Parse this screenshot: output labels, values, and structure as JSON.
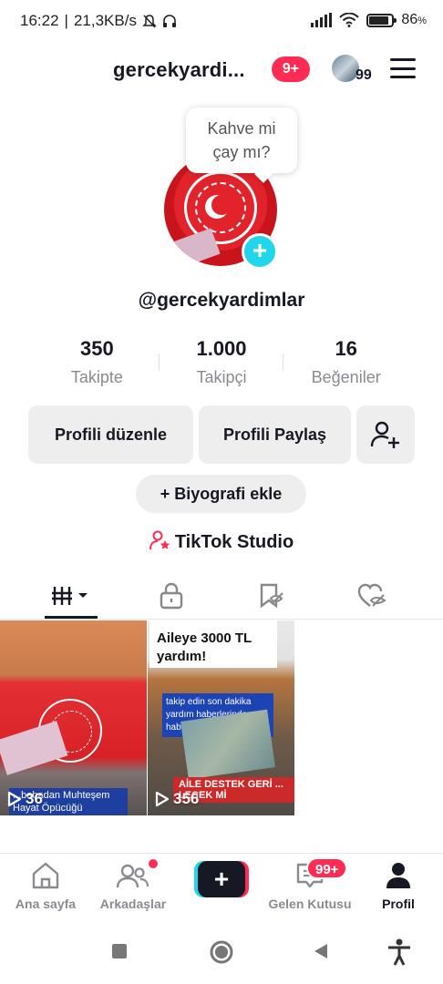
{
  "status_bar": {
    "time": "16:22",
    "network_speed": "21,3KB/s",
    "battery": "86",
    "battery_unit": "%"
  },
  "header": {
    "username": "gercekyardi...",
    "notification_badge": "9+",
    "friends_count": "99"
  },
  "profile": {
    "bubble_line1": "Kahve mi",
    "bubble_line2": "çay mı?",
    "handle": "@gercekyardimlar",
    "stats": [
      {
        "value": "350",
        "label": "Takipte"
      },
      {
        "value": "1.000",
        "label": "Takipçi"
      },
      {
        "value": "16",
        "label": "Beğeniler"
      }
    ],
    "edit_profile": "Profili düzenle",
    "share_profile": "Profili Paylaş",
    "add_bio": "Biyografi ekle",
    "tiktok_studio": "TikTok Studio"
  },
  "videos": [
    {
      "caption": "...babadan Muhteşem Hayat Öpücüğü",
      "views": "36"
    },
    {
      "title": "Aileye 3000 TL yardım!",
      "caption": "takip edin son dakika yardım haberlerinden haber dar olun",
      "banner": "AİLE DESTEK GERİ ... LECEK Mİ",
      "views": "356"
    }
  ],
  "bottom_nav": {
    "home": "Ana sayfa",
    "friends": "Arkadaşlar",
    "inbox": "Gelen Kutusu",
    "inbox_badge": "99+",
    "profile": "Profil"
  },
  "colors": {
    "accent_red": "#fe2c55",
    "accent_cyan": "#20d5ec"
  }
}
